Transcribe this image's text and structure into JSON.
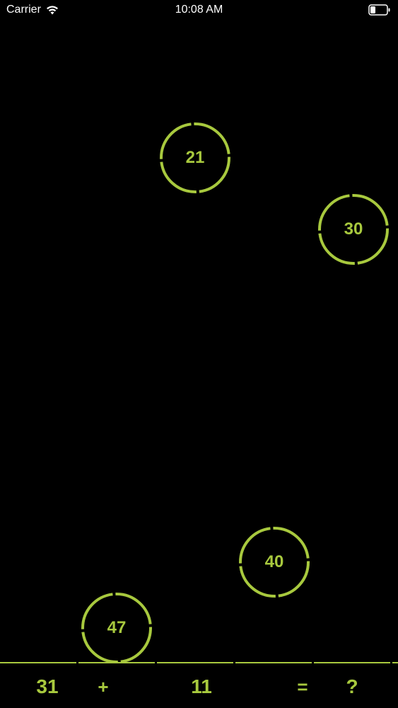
{
  "status_bar": {
    "carrier": "Carrier",
    "time": "10:08 AM",
    "icons": [
      "wifi-icon",
      "battery-icon"
    ]
  },
  "bubbles": [
    {
      "value": "21"
    },
    {
      "value": "30"
    },
    {
      "value": "40"
    },
    {
      "value": "47"
    }
  ],
  "equation": {
    "operand1": "31",
    "operator": "+",
    "operand2": "11",
    "equals": "=",
    "result": "?"
  },
  "colors": {
    "accent": "#a8c93e",
    "background": "#000000"
  }
}
